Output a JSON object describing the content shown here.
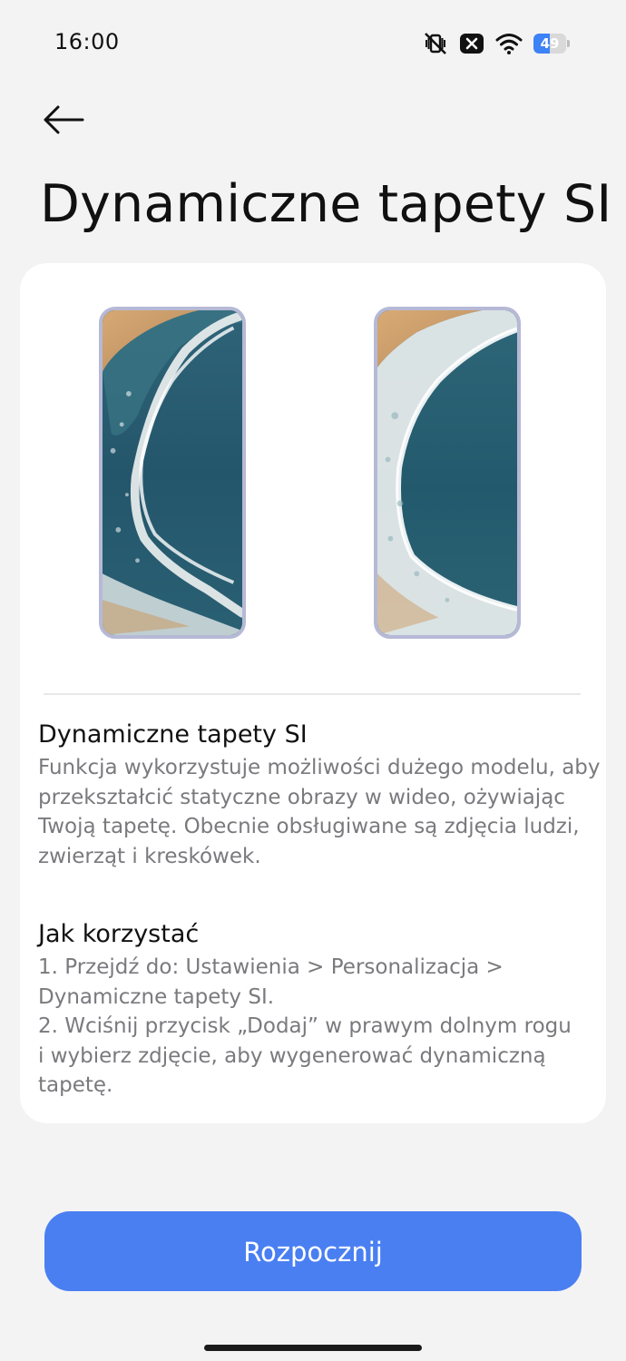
{
  "status_bar": {
    "time": "16:00",
    "battery_level": "49",
    "battery_percent": 49,
    "icons": [
      "vibrate-off-icon",
      "notification-x-icon",
      "wifi-icon",
      "battery-icon"
    ]
  },
  "header": {
    "back_icon": "arrow-left-icon",
    "title": "Dynamiczne tapety SI"
  },
  "card": {
    "previews": [
      {
        "name": "beach-wallpaper-before",
        "description_icon": "static-image"
      },
      {
        "name": "beach-wallpaper-after",
        "description_icon": "animated-image"
      }
    ],
    "sections": [
      {
        "title": "Dynamiczne tapety SI",
        "lines": [
          "Funkcja wykorzystuje możliwości dużego modelu, aby",
          "przekształcić statyczne obrazy w wideo, ożywiając",
          "Twoją tapetę. Obecnie obsługiwane są zdjęcia ludzi,",
          "zwierząt i kreskówek."
        ]
      },
      {
        "title": "Jak korzystać",
        "lines": [
          "1. Przejdź do: Ustawienia > Personalizacja >",
          "Dynamiczne tapety SI.",
          "2. Wciśnij przycisk „Dodaj” w prawym dolnym rogu",
          "i wybierz zdjęcie, aby wygenerować dynamiczną",
          "tapetę."
        ]
      }
    ]
  },
  "actions": {
    "start_label": "Rozpocznij"
  },
  "colors": {
    "background": "#f3f3f4",
    "card": "#ffffff",
    "accent": "#4a7ff2",
    "secondary_text": "#7a7a7e",
    "preview_frame": "#b6b9d6"
  }
}
